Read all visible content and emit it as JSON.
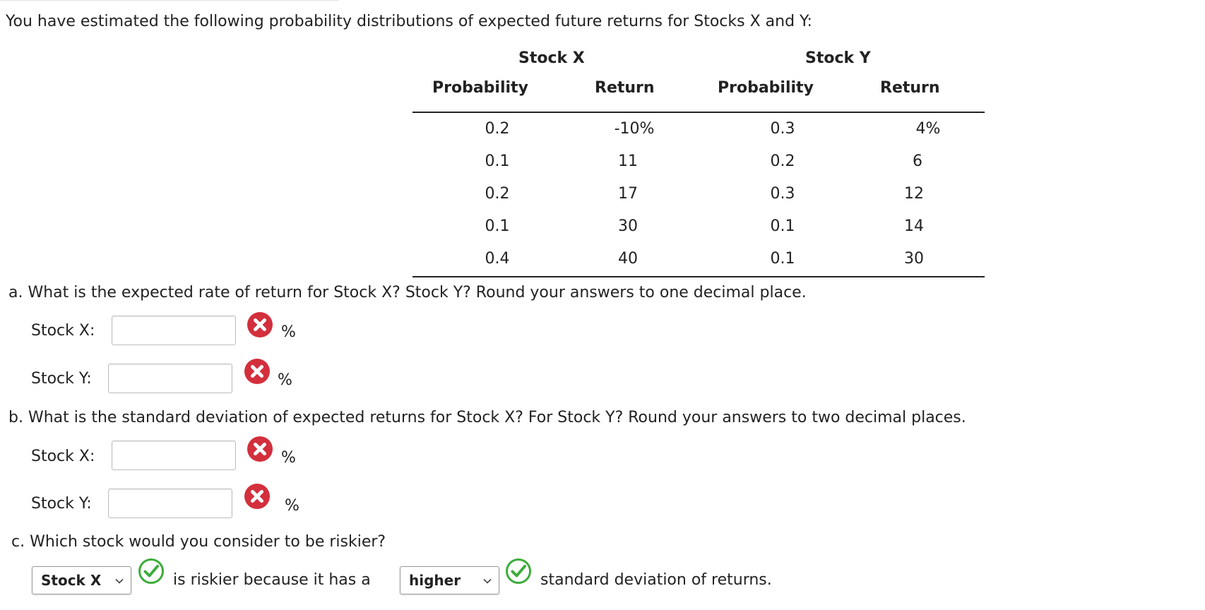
{
  "intro": "You have estimated the following probability distributions of expected future returns for Stocks X and Y:",
  "table": {
    "group_x": "Stock X",
    "group_y": "Stock Y",
    "col_prob_x": "Probability",
    "col_ret_x": "Return",
    "col_prob_y": "Probability",
    "col_ret_y": "Return",
    "rows": [
      {
        "px": "0.2",
        "rx": "-10%",
        "py": "0.3",
        "ry": "4%"
      },
      {
        "px": "0.1",
        "rx": "11",
        "py": "0.2",
        "ry": "6"
      },
      {
        "px": "0.2",
        "rx": "17",
        "py": "0.3",
        "ry": "12"
      },
      {
        "px": "0.1",
        "rx": "30",
        "py": "0.1",
        "ry": "14"
      },
      {
        "px": "0.4",
        "rx": "40",
        "py": "0.1",
        "ry": "30"
      }
    ]
  },
  "part_a": {
    "question": "a. What is the expected rate of return for Stock X? Stock Y? Round your answers to one decimal place.",
    "x_label": "Stock X:",
    "y_label": "Stock Y:",
    "x_value": "",
    "y_value": "",
    "unit": "%"
  },
  "part_b": {
    "question": "b. What is the standard deviation of expected returns for Stock X? For Stock Y? Round your answers to two decimal places.",
    "x_label": "Stock X:",
    "y_label": "Stock Y:",
    "x_value": "",
    "y_value": "",
    "unit": "%"
  },
  "part_c": {
    "question": "c. Which stock would you consider to be riskier?",
    "stock_select": "Stock X",
    "middle_text": "is riskier because it has a",
    "level_select": "higher",
    "end_text": "standard deviation of returns."
  },
  "icons": {
    "incorrect": "x-circle-icon",
    "correct": "check-circle-icon"
  },
  "colors": {
    "incorrect": "#d32f3c",
    "correct": "#3cac3a"
  }
}
